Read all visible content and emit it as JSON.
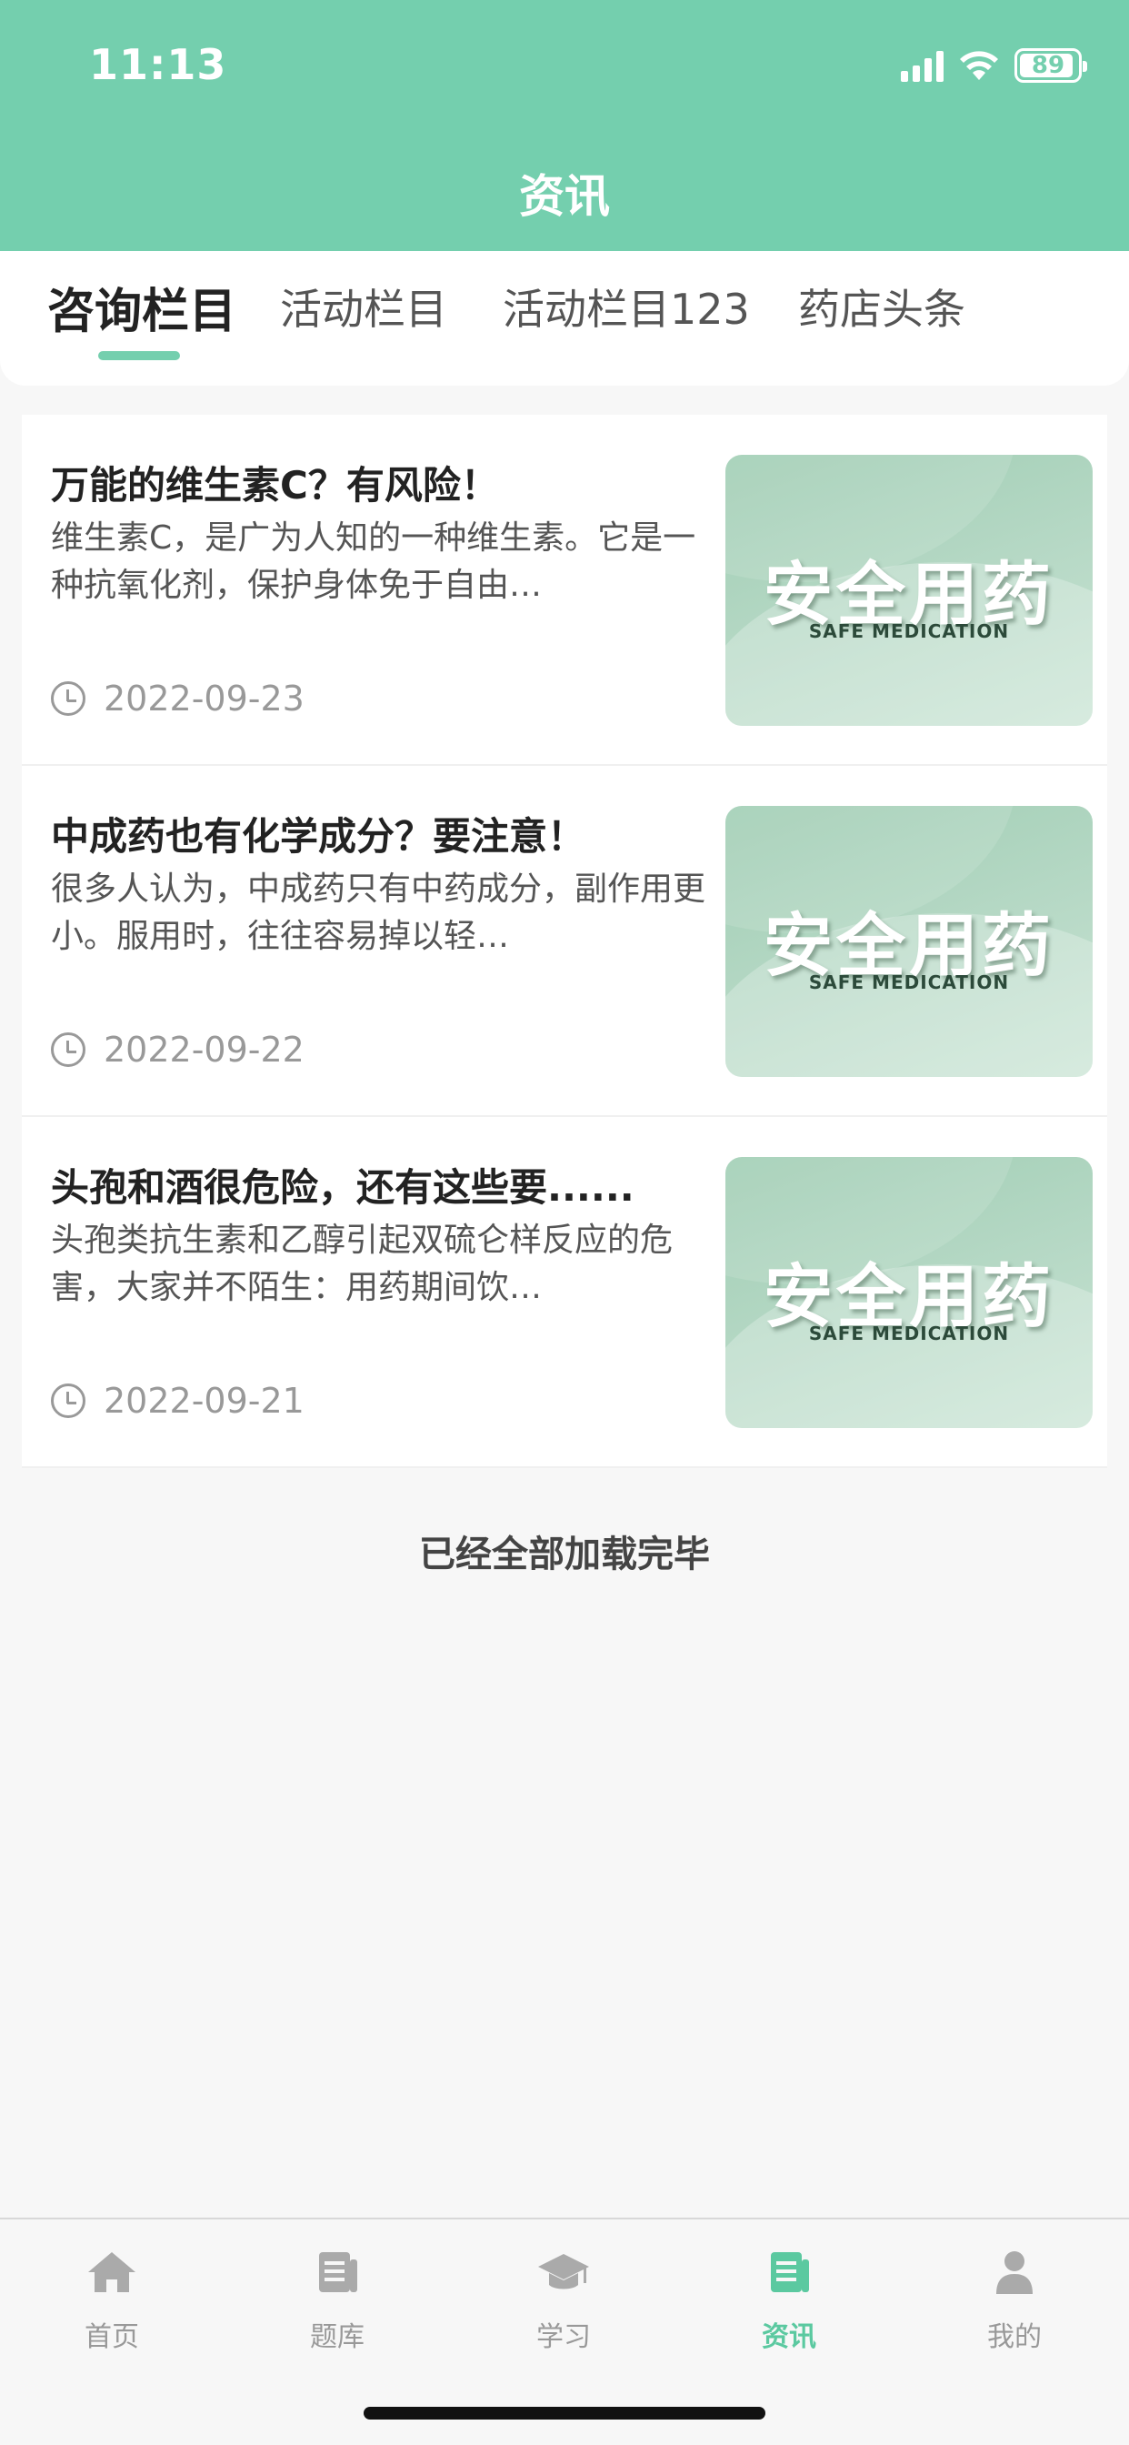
{
  "status_bar": {
    "time": "11:13",
    "battery": "89"
  },
  "header": {
    "title": "资讯"
  },
  "tabs": [
    {
      "label": "咨询栏目",
      "active": true
    },
    {
      "label": "活动栏目",
      "active": false
    },
    {
      "label": "活动栏目123",
      "active": false
    },
    {
      "label": "药店头条",
      "active": false
    }
  ],
  "articles": [
    {
      "title": "万能的维生素C？有风险！",
      "summary": "维生素C，是广为人知的一种维生素。它是一种抗氧化剂，保护身体免于自由…",
      "date": "2022-09-23",
      "thumb_main": "安全用药",
      "thumb_sub": "SAFE MEDICATION"
    },
    {
      "title": "中成药也有化学成分？要注意！",
      "summary": "很多人认为，中成药只有中药成分，副作用更小。服用时，往往容易掉以轻…",
      "date": "2022-09-22",
      "thumb_main": "安全用药",
      "thumb_sub": "SAFE MEDICATION"
    },
    {
      "title": "头孢和酒很危险，还有这些要......",
      "summary": "头孢类抗生素和乙醇引起双硫仑样反应的危害，大家并不陌生：用药期间饮…",
      "date": "2022-09-21",
      "thumb_main": "安全用药",
      "thumb_sub": "SAFE MEDICATION"
    }
  ],
  "list_end_text": "已经全部加载完毕",
  "bottom_nav": [
    {
      "label": "首页",
      "icon": "home-icon",
      "active": false
    },
    {
      "label": "题库",
      "icon": "question-bank-icon",
      "active": false
    },
    {
      "label": "学习",
      "icon": "graduation-cap-icon",
      "active": false
    },
    {
      "label": "资讯",
      "icon": "news-icon",
      "active": true
    },
    {
      "label": "我的",
      "icon": "user-icon",
      "active": false
    }
  ],
  "colors": {
    "accent": "#74cfae",
    "active_nav": "#5bc9a0",
    "inactive_nav": "#aaaaaa"
  }
}
